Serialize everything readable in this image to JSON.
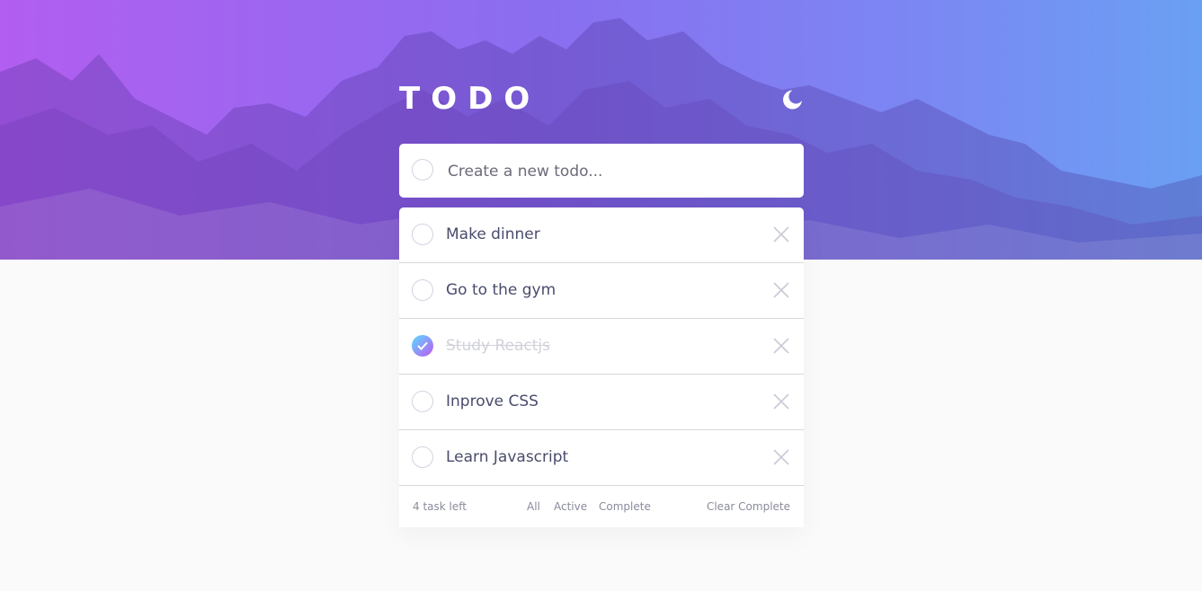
{
  "app": {
    "title": "TODO",
    "theme_toggle_icon": "moon-icon"
  },
  "new_todo": {
    "placeholder": "Create a new todo..."
  },
  "todos": [
    {
      "text": "Make dinner",
      "completed": false
    },
    {
      "text": "Go to the gym",
      "completed": false
    },
    {
      "text": "Study Reactjs",
      "completed": true
    },
    {
      "text": "Inprove CSS",
      "completed": false
    },
    {
      "text": "Learn Javascript",
      "completed": false
    }
  ],
  "footer": {
    "items_left": "4 task left",
    "filter_all": "All",
    "filter_active": "Active",
    "filter_complete": "Complete",
    "clear_completed": "Clear Complete"
  },
  "colors": {
    "hero_gradient_start": "#b25ef0",
    "hero_gradient_end": "#6aa0f3",
    "check_gradient_start": "#57ddff",
    "check_gradient_end": "#c058f3",
    "text": "#494c6b",
    "completed_text": "#d1d2da",
    "page_background": "#fafafa"
  }
}
